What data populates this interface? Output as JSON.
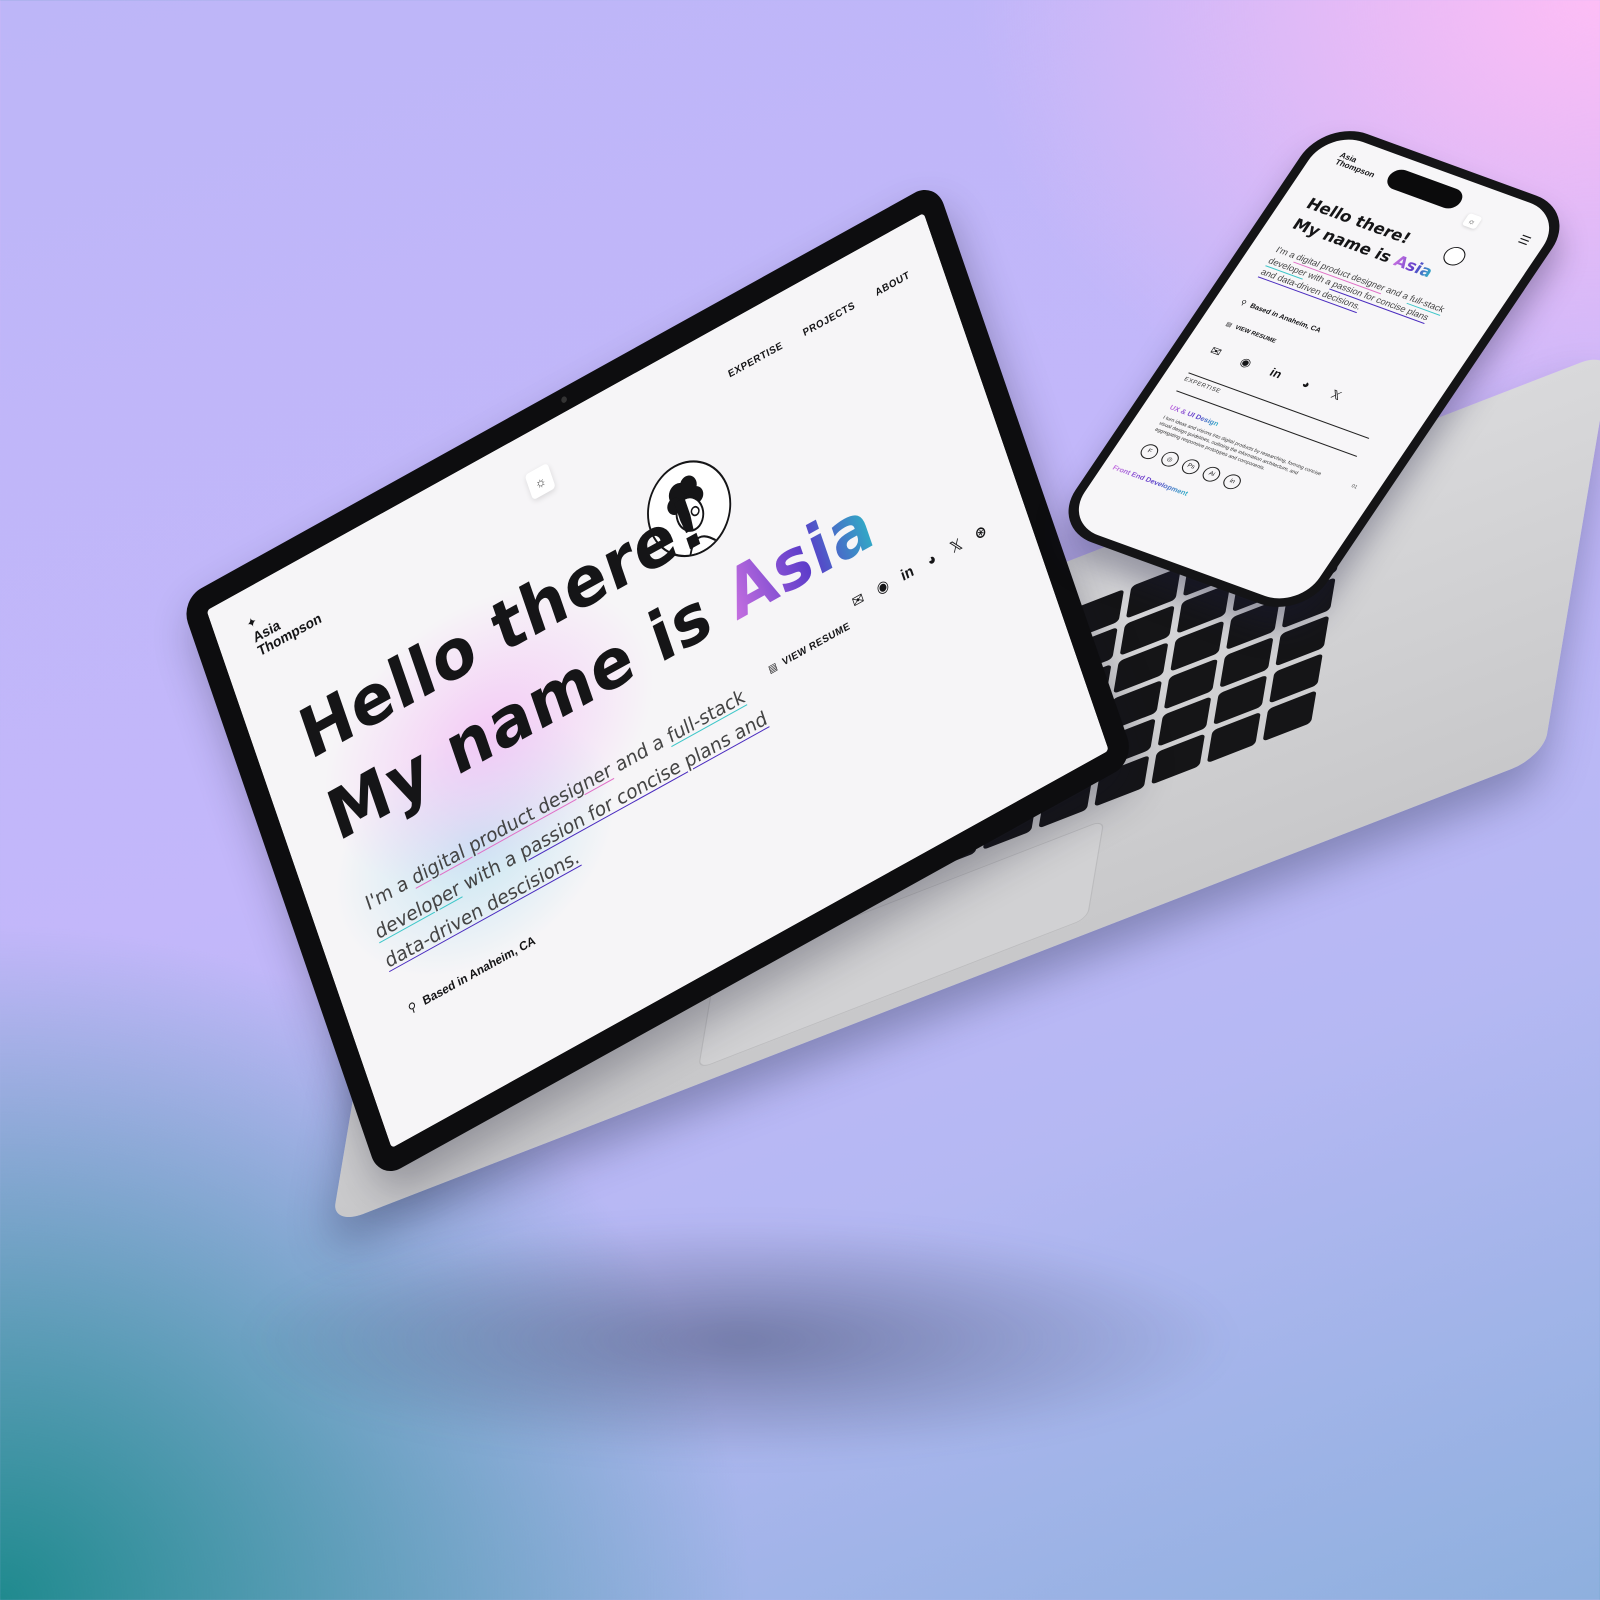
{
  "site": {
    "logo_line1": "Asia",
    "logo_line2": "Thompson",
    "logo_mark": "✦",
    "theme_icon": "☼",
    "nav": [
      "EXPERTISE",
      "PROJECTS",
      "ABOUT"
    ],
    "hero_line1": "Hello there!",
    "hero_line2_prefix": "My name is ",
    "hero_name": "Asia",
    "bio": {
      "part1": "I'm a ",
      "link1": "digital product designer",
      "part2": " and a ",
      "link2": "full-stack developer",
      "part3": " with a ",
      "link3": "passion for concise plans and data-driven descisions."
    },
    "resume_label": "VIEW RESUME",
    "resume_icon": "▤",
    "location": "Based in Anaheim, CA",
    "location_icon": "⚲",
    "socials": [
      {
        "name": "mail-icon",
        "glyph": "✉"
      },
      {
        "name": "github-icon",
        "glyph": "◉"
      },
      {
        "name": "linkedin-icon",
        "glyph": "in"
      },
      {
        "name": "discord-icon",
        "glyph": "◕"
      },
      {
        "name": "x-icon",
        "glyph": "𝕏"
      },
      {
        "name": "dribbble-icon",
        "glyph": "⊛"
      }
    ]
  },
  "mobile": {
    "menu_icon": "☰",
    "bio": {
      "part1": "I'm a ",
      "link1": "digital product designer",
      "part2": " and a ",
      "link2": "full-stack developer",
      "part3": " with a ",
      "link3": "passion for concise plans and data-driven decisions."
    },
    "expertise_label": "EXPERTISE",
    "ux_title": "UX & UI Design",
    "ux_number": "01",
    "ux_desc": "I turn ideas and visions into digital products by researching, forming concise visual design guidelines, outlining the information architecture, and aggregating responsive prototypes and components.",
    "tools": [
      "F",
      "◎",
      "Ps",
      "Ai",
      "in"
    ],
    "next_section": "Front End Development"
  },
  "colors": {
    "accent_pink": "#e06fc6",
    "accent_teal": "#3ec7c9",
    "accent_indigo": "#4a2bbf"
  }
}
